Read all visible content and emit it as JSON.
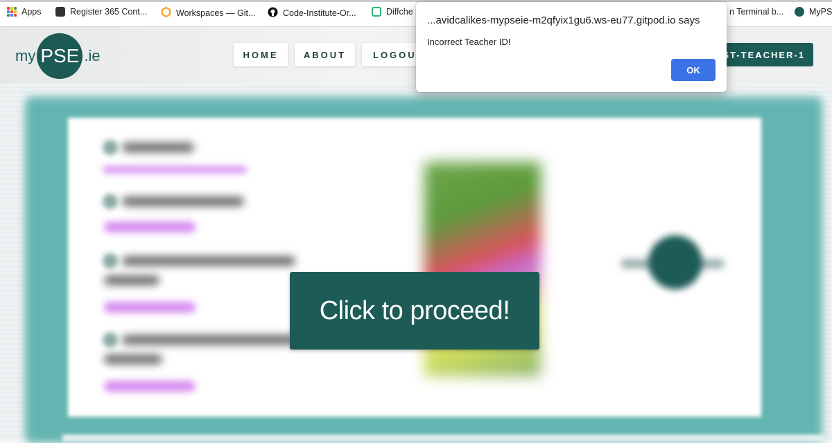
{
  "bookmarks": [
    {
      "label": "Apps",
      "icon": "apps-grid-icon"
    },
    {
      "label": "Register 365 Cont...",
      "icon": "register-icon"
    },
    {
      "label": "Workspaces — Git...",
      "icon": "gitpod-icon"
    },
    {
      "label": "Code-Institute-Or...",
      "icon": "github-icon"
    },
    {
      "label": "Diffche",
      "icon": "diffchecker-icon"
    },
    {
      "label": "n Terminal b...",
      "icon": "terminal-icon"
    },
    {
      "label": "MyPS",
      "icon": "mypse-favicon-icon"
    }
  ],
  "header": {
    "logo": {
      "prefix": "my",
      "core": "PSE",
      "suffix": ".ie"
    },
    "nav": {
      "home": "HOME",
      "about": "ABOUT",
      "logout": "LOGOUT"
    },
    "teacher": "ST-TEACHER-1"
  },
  "main": {
    "proceed_label": "Click to proceed!"
  },
  "dialog": {
    "title": "...avidcalikes-mypseie-m2qfyix1gu6.ws-eu77.gitpod.io says",
    "message": "Incorrect Teacher ID!",
    "ok_label": "OK"
  },
  "colors": {
    "brand": "#1d5b56",
    "panel": "#64b5b1",
    "dialog_button": "#3b72e6"
  }
}
